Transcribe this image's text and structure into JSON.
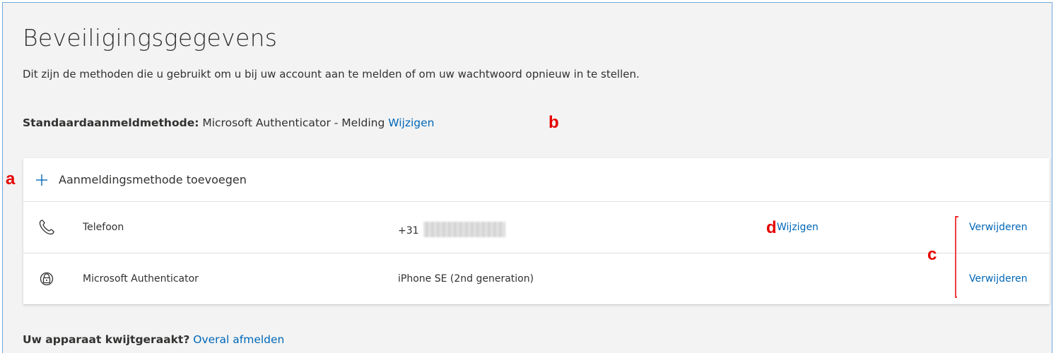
{
  "page": {
    "title": "Beveiligingsgegevens",
    "description": "Dit zijn de methoden die u gebruikt om u bij uw account aan te melden of om uw wachtwoord opnieuw in te stellen."
  },
  "default_method": {
    "label": "Standaardaanmeldmethode:",
    "value": "Microsoft Authenticator - Melding",
    "change_link": "Wijzigen"
  },
  "add_method": {
    "icon": "plus-icon",
    "label": "Aanmeldingsmethode toevoegen"
  },
  "methods": [
    {
      "icon": "phone-icon",
      "name": "Telefoon",
      "detail": "+31",
      "detail_redacted": true,
      "change_label": "Wijzigen",
      "remove_label": "Verwijderen"
    },
    {
      "icon": "authenticator-lock-icon",
      "name": "Microsoft Authenticator",
      "detail": "iPhone SE (2nd generation)",
      "remove_label": "Verwijderen"
    }
  ],
  "annotations": {
    "a": "a",
    "b": "b",
    "c": "c",
    "d": "d"
  },
  "footer": {
    "question": "Uw apparaat kwijtgeraakt?",
    "link": "Overal afmelden"
  },
  "colors": {
    "link": "#0067b8",
    "annotation": "#e60000",
    "frame_border": "#6fa8dc",
    "background": "#f3f3f3"
  }
}
